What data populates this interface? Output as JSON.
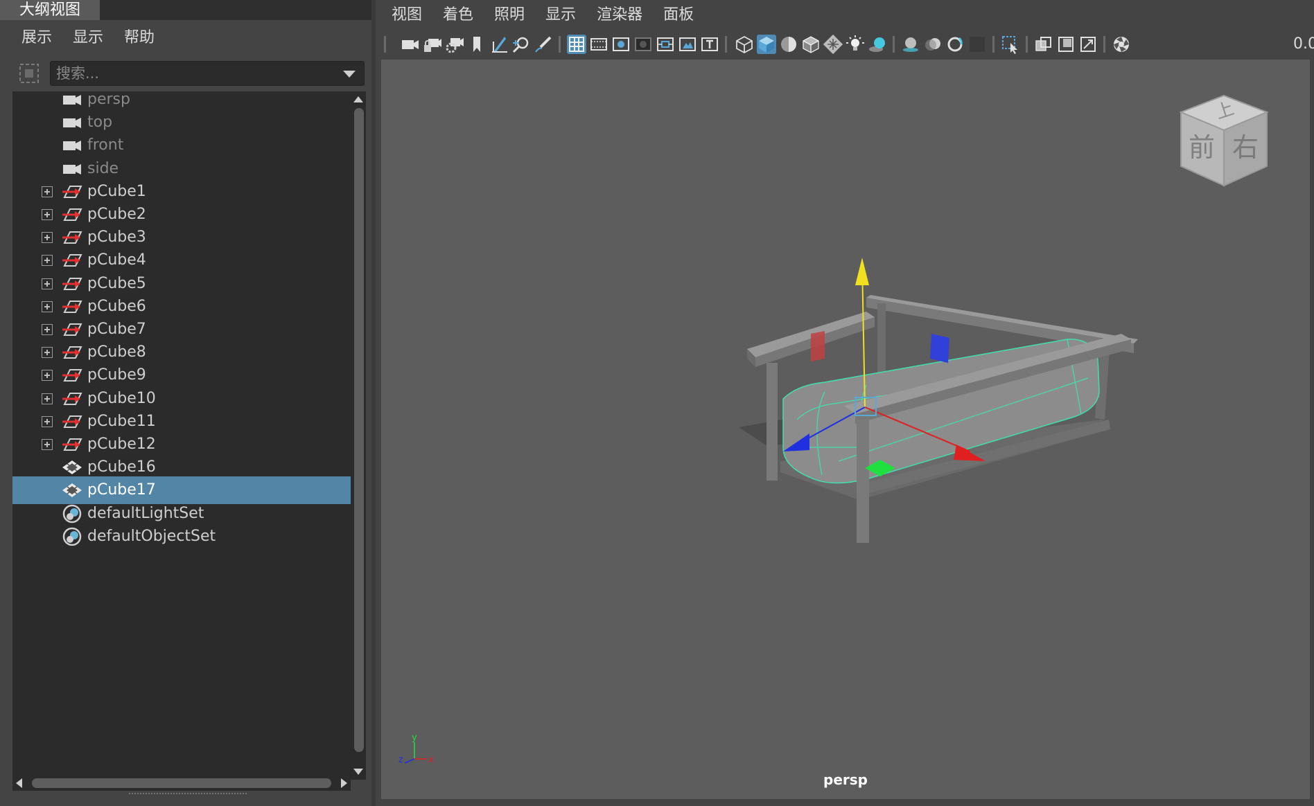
{
  "outliner": {
    "tab_title": "大纲视图",
    "menu": [
      "展示",
      "显示",
      "帮助"
    ],
    "search_placeholder": "搜索...",
    "items": [
      {
        "label": "persp",
        "icon": "camera-icon",
        "expandable": false,
        "dim": true,
        "selected": false
      },
      {
        "label": "top",
        "icon": "camera-icon",
        "expandable": false,
        "dim": true,
        "selected": false
      },
      {
        "label": "front",
        "icon": "camera-icon",
        "expandable": false,
        "dim": true,
        "selected": false
      },
      {
        "label": "side",
        "icon": "camera-icon",
        "expandable": false,
        "dim": true,
        "selected": false
      },
      {
        "label": "pCube1",
        "icon": "transform-icon",
        "expandable": true,
        "dim": false,
        "selected": false
      },
      {
        "label": "pCube2",
        "icon": "transform-icon",
        "expandable": true,
        "dim": false,
        "selected": false
      },
      {
        "label": "pCube3",
        "icon": "transform-icon",
        "expandable": true,
        "dim": false,
        "selected": false
      },
      {
        "label": "pCube4",
        "icon": "transform-icon",
        "expandable": true,
        "dim": false,
        "selected": false
      },
      {
        "label": "pCube5",
        "icon": "transform-icon",
        "expandable": true,
        "dim": false,
        "selected": false
      },
      {
        "label": "pCube6",
        "icon": "transform-icon",
        "expandable": true,
        "dim": false,
        "selected": false
      },
      {
        "label": "pCube7",
        "icon": "transform-icon",
        "expandable": true,
        "dim": false,
        "selected": false
      },
      {
        "label": "pCube8",
        "icon": "transform-icon",
        "expandable": true,
        "dim": false,
        "selected": false
      },
      {
        "label": "pCube9",
        "icon": "transform-icon",
        "expandable": true,
        "dim": false,
        "selected": false
      },
      {
        "label": "pCube10",
        "icon": "transform-icon",
        "expandable": true,
        "dim": false,
        "selected": false
      },
      {
        "label": "pCube11",
        "icon": "transform-icon",
        "expandable": true,
        "dim": false,
        "selected": false
      },
      {
        "label": "pCube12",
        "icon": "transform-icon",
        "expandable": true,
        "dim": false,
        "selected": false
      },
      {
        "label": "pCube16",
        "icon": "mesh-icon",
        "expandable": false,
        "dim": false,
        "selected": false
      },
      {
        "label": "pCube17",
        "icon": "mesh-icon",
        "expandable": false,
        "dim": false,
        "selected": true
      },
      {
        "label": "defaultLightSet",
        "icon": "set-icon",
        "expandable": false,
        "dim": false,
        "selected": false
      },
      {
        "label": "defaultObjectSet",
        "icon": "set-icon",
        "expandable": false,
        "dim": false,
        "selected": false
      }
    ]
  },
  "viewport_panel": {
    "menu": [
      "视图",
      "着色",
      "照明",
      "显示",
      "渲染器",
      "面板"
    ],
    "toolbar_icons": [
      "camera-icon",
      "lock-camera-icon",
      "camera-attributes-icon",
      "bookmark-icon",
      "image-plane-icon",
      "2d-pan-zoom-icon",
      "grease-pencil-icon",
      "grid-icon",
      "film-gate-icon",
      "resolution-gate-icon",
      "gate-mask-icon",
      "field-chart-icon",
      "safe-action-icon",
      "safe-title-icon",
      "wireframe-icon",
      "smooth-shade-icon",
      "default-material-icon",
      "wireframe-on-shaded-icon",
      "textured-icon",
      "use-all-lights-icon",
      "shadows-icon",
      "screen-space-ao-icon",
      "motion-blur-icon",
      "multisample-aa-icon",
      "depth-of-field-icon",
      "isolate-select-icon",
      "xray-icon",
      "xray-joints-icon",
      "xray-components-icon",
      "exposure-icon"
    ],
    "zoom_value": "0.0",
    "viewcube": {
      "top": "上",
      "front": "前",
      "right": "右"
    },
    "camera_name": "persp",
    "axis_labels": {
      "x": "x",
      "y": "y",
      "z": "z"
    }
  },
  "colors": {
    "selection": "#5285a6",
    "x_axis": "#e02020",
    "y_axis": "#f0e020",
    "z_axis": "#2030e0",
    "wireframe_highlight": "#40e0b0"
  }
}
